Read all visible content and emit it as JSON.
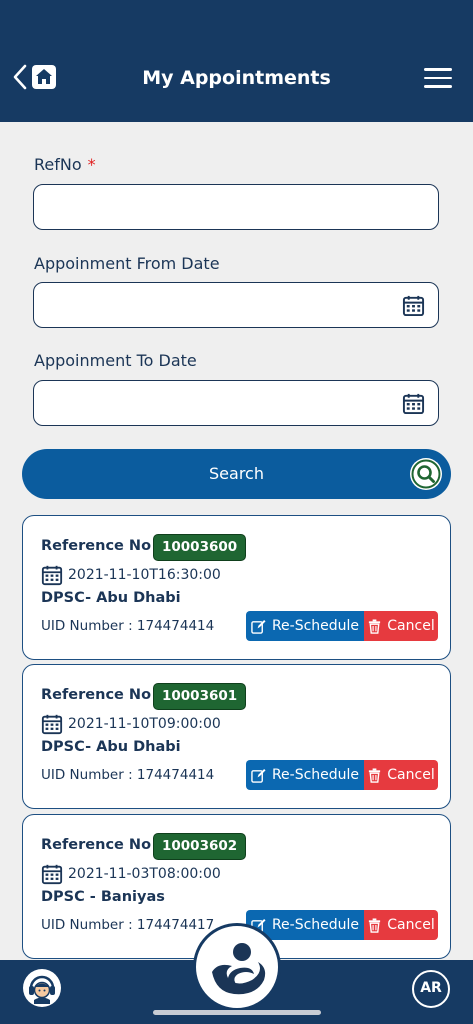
{
  "header": {
    "title": "My Appointments"
  },
  "form": {
    "refno_label": "RefNo",
    "required_mark": "*",
    "refno_value": "",
    "from_label": "Appoinment From Date",
    "from_value": "",
    "to_label": "Appoinment To Date",
    "to_value": "",
    "search_label": "Search"
  },
  "appointments": [
    {
      "ref_label": "Reference No",
      "ref_no": "10003600",
      "datetime": "2021-11-10T16:30:00",
      "center": "DPSC- Abu Dhabi",
      "uid": "UID Number : 174474414",
      "reschedule_label": "Re-Schedule",
      "cancel_label": "Cancel"
    },
    {
      "ref_label": "Reference No",
      "ref_no": "10003601",
      "datetime": "2021-11-10T09:00:00",
      "center": "DPSC- Abu Dhabi",
      "uid": "UID Number : 174474414",
      "reschedule_label": "Re-Schedule",
      "cancel_label": "Cancel"
    },
    {
      "ref_label": "Reference No",
      "ref_no": "10003602",
      "datetime": "2021-11-03T08:00:00",
      "center": "DPSC - Baniyas",
      "uid": "UID Number : 174474417",
      "reschedule_label": "Re-Schedule",
      "cancel_label": "Cancel"
    }
  ],
  "bottom_nav": {
    "language_label": "AR"
  },
  "icons": {
    "back": "chevron-left-icon",
    "home": "home-icon",
    "menu": "hamburger-menu-icon",
    "calendar": "calendar-icon",
    "search": "search-icon",
    "edit": "edit-icon",
    "trash": "trash-icon",
    "support": "support-agent-icon",
    "logo": "app-logo-icon"
  },
  "colors": {
    "header_bg": "#163a63",
    "primary_button": "#0b5c9e",
    "badge_green": "#1f6632",
    "cancel_red": "#e63a3f",
    "reschedule_blue": "#0b68b1"
  }
}
